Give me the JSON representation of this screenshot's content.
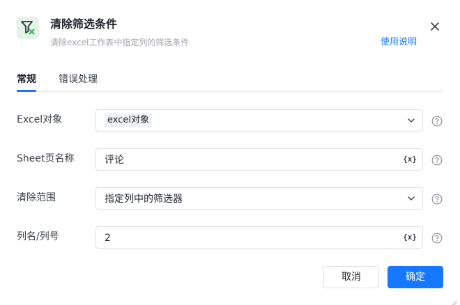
{
  "header": {
    "title": "清除筛选条件",
    "subtitle": "清除excel工作表中指定列的筛选条件",
    "help_link": "使用说明",
    "icon": "filter-clear-icon",
    "icon_color": "#3db45a"
  },
  "tabs": [
    {
      "label": "常规",
      "active": true
    },
    {
      "label": "错误处理",
      "active": false
    }
  ],
  "form": {
    "excel_object": {
      "label": "Excel对象",
      "value": "excel对象"
    },
    "sheet_name": {
      "label": "Sheet页名称",
      "value": "评论",
      "var_button": "{x}"
    },
    "clear_range": {
      "label": "清除范围",
      "value": "指定列中的筛选器"
    },
    "column": {
      "label": "列名/列号",
      "value": "2",
      "var_button": "{x}"
    }
  },
  "buttons": {
    "cancel": "取消",
    "ok": "确定"
  },
  "colors": {
    "accent": "#1677ff",
    "border": "#dcdfe4"
  }
}
